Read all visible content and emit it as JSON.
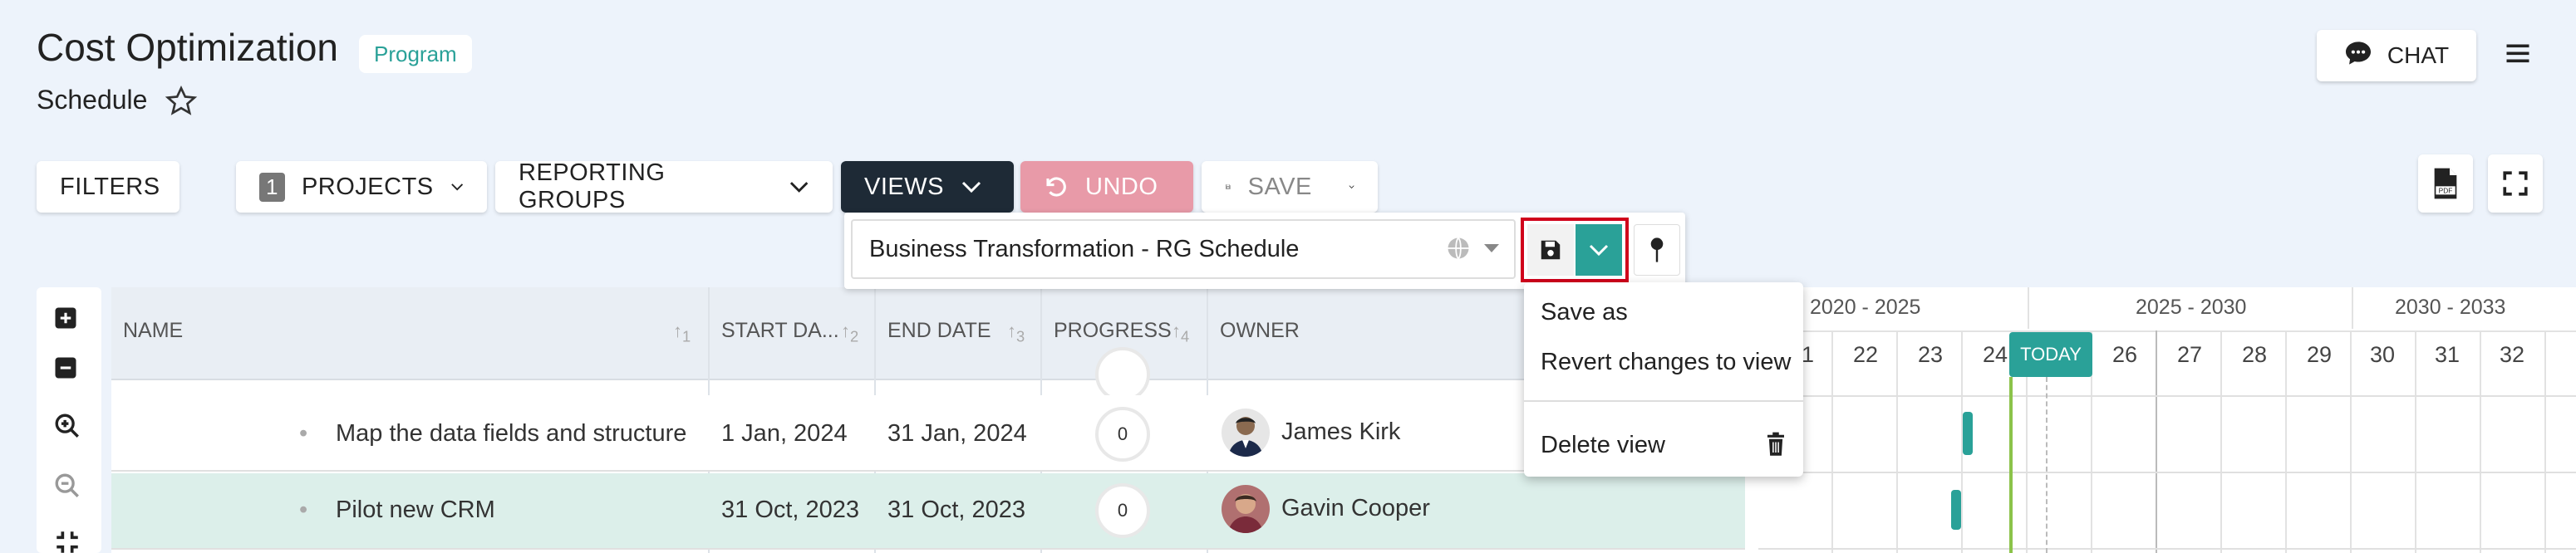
{
  "header": {
    "title": "Cost Optimization",
    "badge": "Program",
    "subtitle": "Schedule",
    "chat_label": "CHAT"
  },
  "toolbar": {
    "filters_label": "FILTERS",
    "projects_count": "1",
    "projects_label": "PROJECTS",
    "reporting_groups_label": "REPORTING GROUPS",
    "views_label": "VIEWS",
    "undo_label": "UNDO",
    "save_label": "SAVE"
  },
  "views_panel": {
    "selected_view": "Business Transformation - RG Schedule"
  },
  "save_menu": {
    "items": [
      "Save as",
      "Revert changes to view",
      "Delete view"
    ]
  },
  "table": {
    "columns": [
      "NAME",
      "START DA...",
      "END DATE",
      "PROGRESS",
      "OWNER"
    ],
    "sort_indices": [
      "1",
      "2",
      "3",
      "4"
    ],
    "rows": [
      {
        "name": "Map the data fields and structure",
        "start": "1 Jan, 2024",
        "end": "31 Jan, 2024",
        "progress": "0",
        "owner": "James Kirk"
      },
      {
        "name": "Pilot new CRM",
        "start": "31 Oct, 2023",
        "end": "31 Oct, 2023",
        "progress": "0",
        "owner": "Gavin Cooper"
      }
    ]
  },
  "gantt": {
    "periods": [
      "2020 - 2025",
      "2025 - 2030",
      "2030 - 2033"
    ],
    "years": [
      "1",
      "22",
      "23",
      "24",
      "26",
      "27",
      "28",
      "29",
      "30",
      "31",
      "32"
    ],
    "today_label": "TODAY"
  },
  "colors": {
    "accent": "#2aa198",
    "views_bg": "#1e2a36",
    "undo_bg": "#e89aa8",
    "highlight_outline": "#d0021b",
    "selected_row": "#dcefea"
  }
}
